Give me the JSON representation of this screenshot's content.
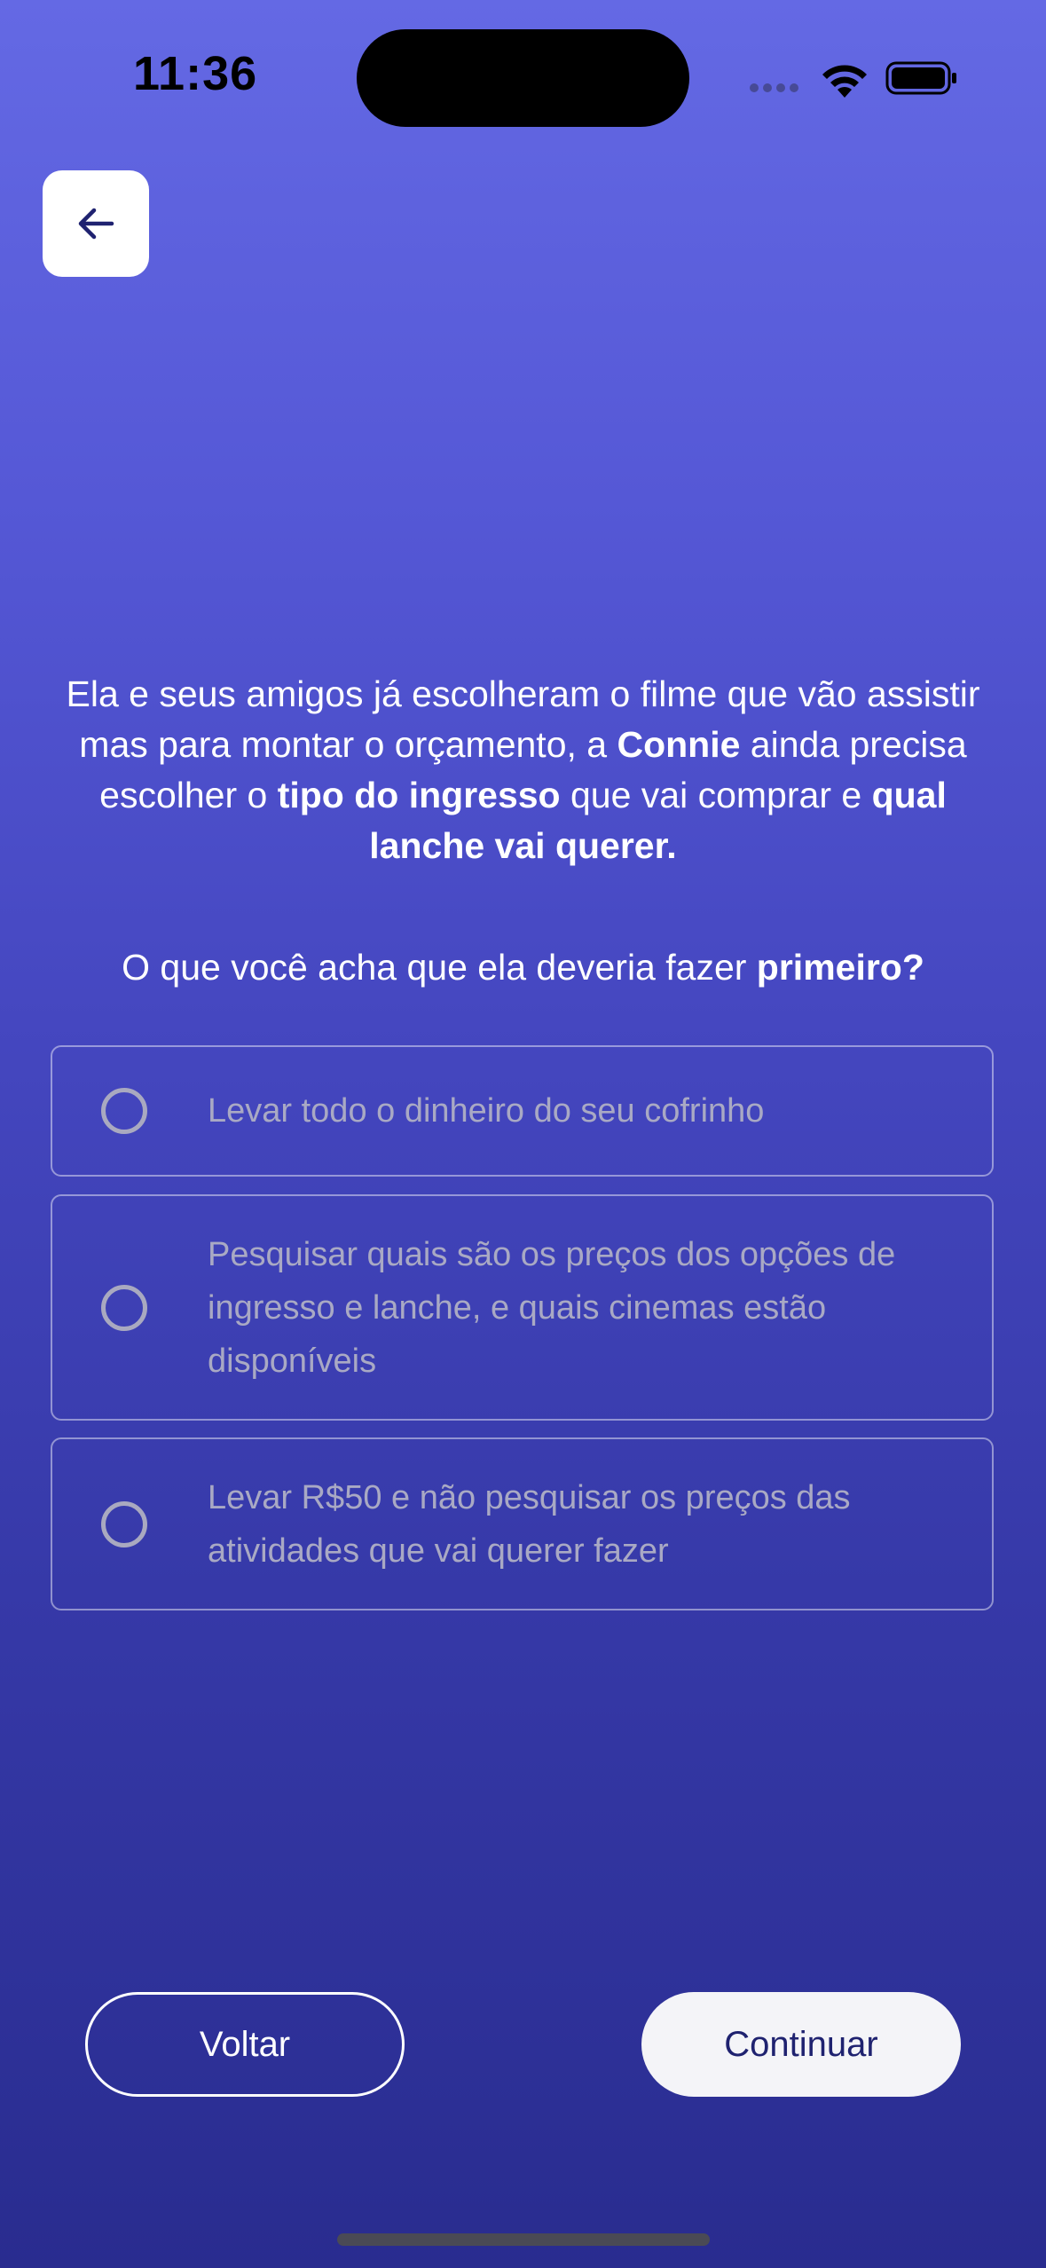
{
  "status_bar": {
    "time": "11:36"
  },
  "header": {
    "back_icon": "arrow-left-icon"
  },
  "question": {
    "line_parts": [
      "Ela e seus amigos já escolheram o filme que vão assistir mas para montar o orçamento, a ",
      "Connie",
      " ainda precisa escolher o ",
      "tipo do ingresso",
      " que vai comprar e ",
      "qual lanche vai querer",
      "."
    ],
    "prompt_parts": [
      "O que você acha que ela deveria fazer ",
      "primeiro?"
    ]
  },
  "options": [
    {
      "label": "Levar todo o dinheiro do seu cofrinho",
      "selected": false
    },
    {
      "label": "Pesquisar quais são os preços dos opções de ingresso e lanche, e quais cinemas estão disponíveis",
      "selected": false
    },
    {
      "label": "Levar R$50 e não pesquisar os preços das atividades que vai querer fazer",
      "selected": false
    }
  ],
  "footer": {
    "back_label": "Voltar",
    "continue_label": "Continuar"
  },
  "colors": {
    "gradient_top": "#6469e4",
    "gradient_bottom": "#292c8f",
    "option_text": "#a9a9c4",
    "continue_text": "#1f2270"
  }
}
